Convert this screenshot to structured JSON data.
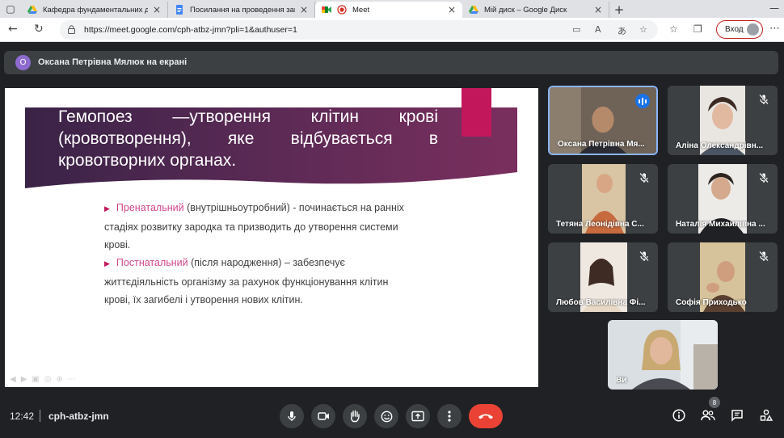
{
  "browser": {
    "tabs": [
      {
        "title": "Кафедра фундаментальних дисц",
        "icon": "google-drive-icon"
      },
      {
        "title": "Посилання на проведення занят",
        "icon": "google-docs-icon"
      },
      {
        "title": "Meet",
        "icon": "google-meet-icon",
        "active": true
      },
      {
        "title": "Мій диск – Google Диск",
        "icon": "google-drive-icon"
      }
    ],
    "url": "https://meet.google.com/cph-atbz-jmn?pli=1&authuser=1",
    "signin_label": "Вход"
  },
  "meet": {
    "presenter_initial": "О",
    "presenter_banner": "Оксана Петрівна Мялюк на екрані",
    "slide": {
      "title": "Гемопоез —утворення клітин крові (кровотворення), яке відбувається в кровотворних органах.",
      "bullet1_term": "Пренатальний",
      "bullet1_text": " (внутрішньоутробний) - починається на ранніх стадіях розвитку зародка та призводить до утворення системи крові.",
      "bullet2_term": "Постнатальний",
      "bullet2_text": " (після народження) – забезпечує життєдіяльність організму за рахунок функціонування клітин крові, їх загибелі і утворення нових клітин."
    },
    "participants": [
      {
        "name": "Оксана Петрівна Мя...",
        "speaking": true
      },
      {
        "name": "Аліна Олександрівн...",
        "muted": true
      },
      {
        "name": "Тетяна Леонідівна С...",
        "muted": true
      },
      {
        "name": "Наталія Михайлівна ...",
        "muted": true
      },
      {
        "name": "Любов Василівна Фі...",
        "muted": true
      },
      {
        "name": "Софія Приходько",
        "muted": true
      },
      {
        "name": "Ви"
      }
    ],
    "time": "12:42",
    "meeting_code": "cph-atbz-jmn",
    "people_count": "8",
    "colors": {
      "end_call": "#ea4335",
      "speaking": "#1a73e8",
      "accent": "#c2185b"
    }
  }
}
